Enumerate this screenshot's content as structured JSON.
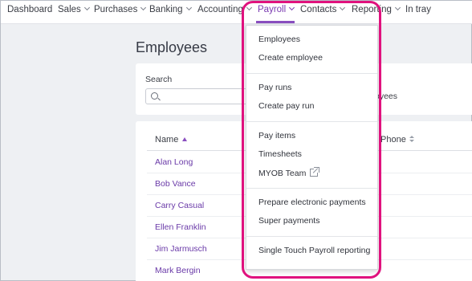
{
  "nav": {
    "items": [
      {
        "label": "Dashboard",
        "chevron": false,
        "active": false
      },
      {
        "label": "Sales",
        "chevron": true,
        "active": false
      },
      {
        "label": "Purchases",
        "chevron": true,
        "active": false
      },
      {
        "label": "Banking",
        "chevron": true,
        "active": false
      },
      {
        "label": "Accounting",
        "chevron": true,
        "active": false
      },
      {
        "label": "Payroll",
        "chevron": true,
        "active": true
      },
      {
        "label": "Contacts",
        "chevron": true,
        "active": false
      },
      {
        "label": "Reporting",
        "chevron": true,
        "active": false
      },
      {
        "label": "In tray",
        "chevron": false,
        "active": false
      }
    ]
  },
  "page": {
    "title": "Employees"
  },
  "search": {
    "label": "Search",
    "value": "",
    "placeholder": "",
    "partial_text": "oyees"
  },
  "table": {
    "columns": [
      {
        "label": "Name",
        "sort": "asc"
      },
      {
        "label": "Phone",
        "sort": "none"
      }
    ],
    "rows": [
      {
        "name": "Alan Long"
      },
      {
        "name": "Bob Vance"
      },
      {
        "name": "Carry Casual"
      },
      {
        "name": "Ellen Franklin"
      },
      {
        "name": "Jim Jarmusch"
      },
      {
        "name": "Mark Bergin"
      }
    ]
  },
  "payroll_menu": {
    "groups": [
      [
        "Employees",
        "Create employee"
      ],
      [
        "Pay runs",
        "Create pay run"
      ],
      [
        "Pay items",
        "Timesheets",
        "MYOB Team"
      ],
      [
        "Prepare electronic payments",
        "Super payments"
      ],
      [
        "Single Touch Payroll reporting"
      ]
    ],
    "external_link_item": "MYOB Team"
  },
  "colors": {
    "accent": "#8a4fc0",
    "link": "#6a3aa8",
    "highlight": "#e0127e"
  }
}
